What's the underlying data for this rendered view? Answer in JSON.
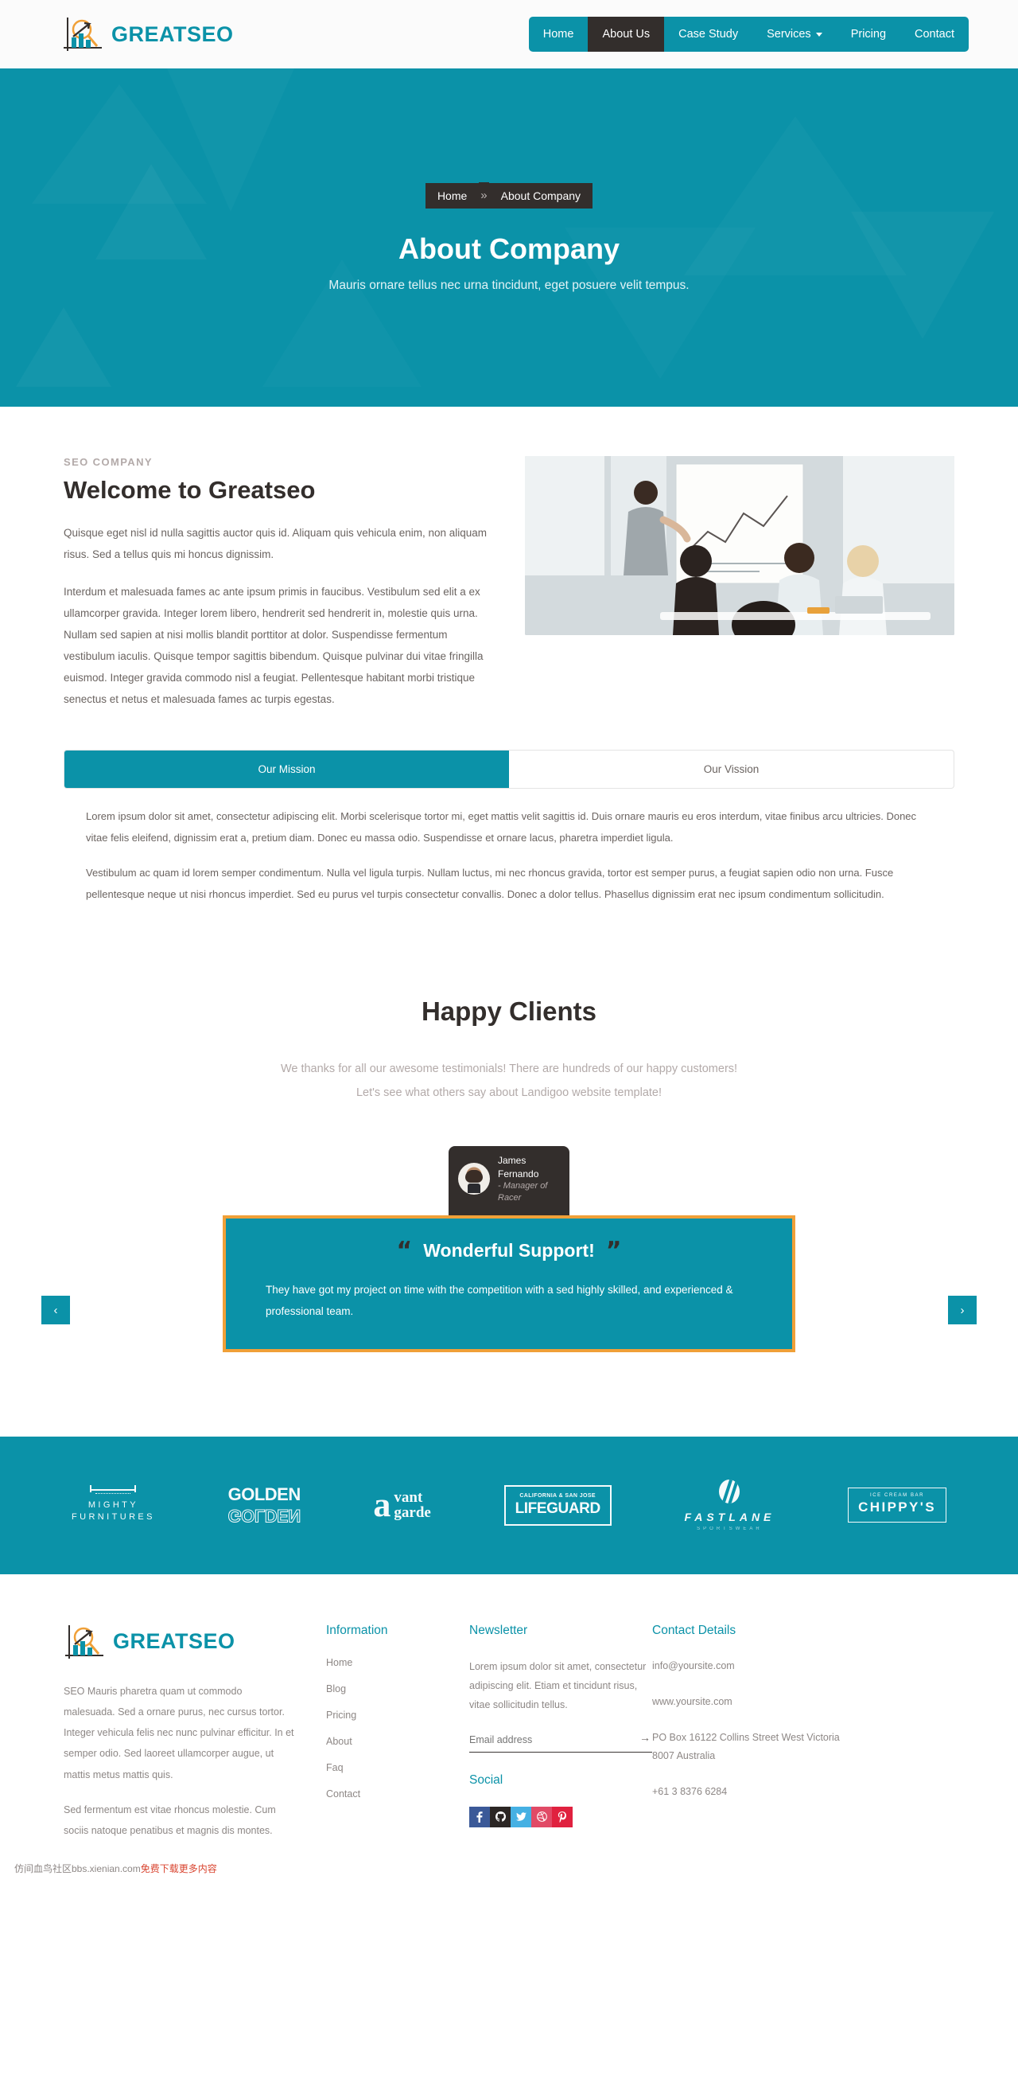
{
  "brand": {
    "name": "GREATSEO",
    "logo_icon": "seo-chart-arrow-logo"
  },
  "nav": {
    "items": [
      {
        "label": "Home",
        "active": false,
        "caret": false
      },
      {
        "label": "About Us",
        "active": true,
        "caret": false
      },
      {
        "label": "Case Study",
        "active": false,
        "caret": false
      },
      {
        "label": "Services",
        "active": false,
        "caret": true
      },
      {
        "label": "Pricing",
        "active": false,
        "caret": false
      },
      {
        "label": "Contact",
        "active": false,
        "caret": false
      }
    ]
  },
  "hero": {
    "breadcrumb": {
      "home": "Home",
      "separator": "»",
      "current": "About Company"
    },
    "title": "About Company",
    "subtitle": "Mauris ornare tellus nec urna tincidunt, eget posuere velit tempus.",
    "bg_color": "#0b92a8"
  },
  "welcome": {
    "eyebrow": "SEO COMPANY",
    "heading": "Welcome to Greatseo",
    "paragraph1": "Quisque eget nisl id nulla sagittis auctor quis id. Aliquam quis vehicula enim, non aliquam risus. Sed a tellus quis mi honcus dignissim.",
    "paragraph2": "Interdum et malesuada fames ac ante ipsum primis in faucibus. Vestibulum sed elit a ex ullamcorper gravida. Integer lorem libero, hendrerit sed hendrerit in, molestie quis urna. Nullam sed sapien at nisi mollis blandit porttitor at dolor. Suspendisse fermentum vestibulum iaculis. Quisque tempor sagittis bibendum. Quisque pulvinar dui vitae fringilla euismod. Integer gravida commodo nisl a feugiat. Pellentesque habitant morbi tristique senectus et netus et malesuada fames ac turpis egestas.",
    "image_alt": "team-meeting-whiteboard-photo"
  },
  "tabs": {
    "items": [
      {
        "label": "Our Mission",
        "active": true
      },
      {
        "label": "Our Vission",
        "active": false
      }
    ],
    "content": {
      "paragraph1": "Lorem ipsum dolor sit amet, consectetur adipiscing elit. Morbi scelerisque tortor mi, eget mattis velit sagittis id. Duis ornare mauris eu eros interdum, vitae finibus arcu ultricies. Donec vitae felis eleifend, dignissim erat a, pretium diam. Donec eu massa odio. Suspendisse et ornare lacus, pharetra imperdiet ligula.",
      "paragraph2": "Vestibulum ac quam id lorem semper condimentum. Nulla vel ligula turpis. Nullam luctus, mi nec rhoncus gravida, tortor est semper purus, a feugiat sapien odio non urna. Fusce pellentesque neque ut nisi rhoncus imperdiet. Sed eu purus vel turpis consectetur convallis. Donec a dolor tellus. Phasellus dignissim erat nec ipsum condimentum sollicitudin."
    }
  },
  "clients": {
    "heading": "Happy Clients",
    "sub_line1": "We thanks for all our awesome testimonials! There are hundreds of our happy customers!",
    "sub_line2": "Let's see what others say about Landigoo website template!"
  },
  "testimonial": {
    "author_name": "James Fernando",
    "author_role": "- Manager of Racer",
    "quote_open": "“",
    "quote_close": "”",
    "title": "Wonderful Support!",
    "body": "They have got my project on time with the competition with a sed highly skilled, and experienced & professional team.",
    "prev_label": "‹",
    "next_label": "›",
    "border_color": "#f0a038",
    "bg_color": "#0b92a8"
  },
  "logobar": {
    "logos": [
      {
        "id": "mighty",
        "line1": "MIGHTY",
        "line2": "FURNITURES"
      },
      {
        "id": "golden",
        "line1": "GOLDEN",
        "line2": "GOLDEN"
      },
      {
        "id": "vant-garde",
        "mark": "a",
        "line1": "vant",
        "line2": "garde"
      },
      {
        "id": "lifeguard",
        "line1": "CALIFORNIA & SAN JOSE",
        "line2": "LIFEGUARD"
      },
      {
        "id": "fastlane",
        "line1": "FASTLANE",
        "line2": "SPORTSWEAR"
      },
      {
        "id": "chippys",
        "line1": "ICE CREAM BAR",
        "line2": "CHIPPY'S"
      }
    ]
  },
  "footer": {
    "brand_name": "GREATSEO",
    "about_p1": "SEO Mauris pharetra quam ut commodo malesuada. Sed a ornare purus, nec cursus tortor. Integer vehicula felis nec nunc pulvinar efficitur. In et semper odio. Sed laoreet ullamcorper augue, ut mattis metus mattis quis.",
    "about_p2": "Sed fermentum est vitae rhoncus molestie. Cum sociis natoque penatibus et magnis dis montes.",
    "information": {
      "title": "Information",
      "links": [
        "Home",
        "Blog",
        "Pricing",
        "About",
        "Faq",
        "Contact"
      ]
    },
    "newsletter": {
      "title": "Newsletter",
      "text": "Lorem ipsum dolor sit amet, consectetur adipiscing elit. Etiam et tincidunt risus, vitae sollicitudin tellus.",
      "input_placeholder": "Email address",
      "input_value": "",
      "submit_icon": "→",
      "social_title": "Social",
      "socials": [
        {
          "name": "facebook-icon",
          "glyph": "f",
          "color": "#3b5998"
        },
        {
          "name": "github-icon",
          "glyph": "⒨",
          "color": "#2b2624"
        },
        {
          "name": "twitter-icon",
          "glyph": "✉",
          "color": "#45b0e3"
        },
        {
          "name": "dribbble-icon",
          "glyph": "⚽",
          "color": "#e14a66"
        },
        {
          "name": "pinterest-icon",
          "glyph": "ⓟ",
          "color": "#e0213f"
        }
      ]
    },
    "contact": {
      "title": "Contact Details",
      "email": "info@yoursite.com",
      "website": "www.yoursite.com",
      "address": "PO Box 16122 Collins Street West Victoria 8007 Australia",
      "phone": "+61 3 8376 6284"
    }
  },
  "watermark": {
    "text_a": "仿间血鸟社区bbs.xienian.com",
    "text_b": "免费下载更多内容"
  }
}
